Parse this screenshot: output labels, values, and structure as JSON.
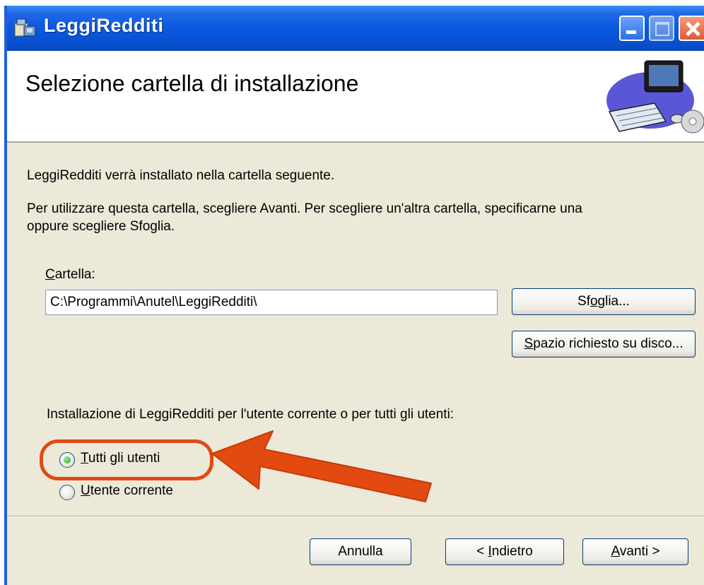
{
  "window": {
    "title": "LeggiRedditi",
    "icon": "installer-icon"
  },
  "titlebar": {
    "minimize": "minimize-icon",
    "maximize": "maximize-icon",
    "close": "close-icon"
  },
  "banner": {
    "title": "Selezione cartella di installazione",
    "graphic": "computer-setup-graphic"
  },
  "body": {
    "intro": "LeggiRedditi verrà installato nella cartella seguente.",
    "instructions_line1": "Per utilizzare questa cartella, scegliere Avanti. Per scegliere un'altra cartella, specificarne una",
    "instructions_line2": "oppure scegliere Sfoglia."
  },
  "folder": {
    "label_access": "C",
    "label_rest": "artella:",
    "value": "C:\\Programmi\\Anutel\\LeggiRedditi\\"
  },
  "browse_button": {
    "pre": "Sf",
    "access": "o",
    "post": "glia..."
  },
  "disk_space_button": {
    "access": "S",
    "post": "pazio richiesto su disco..."
  },
  "install_scope": {
    "question": "Installazione di LeggiRedditi per l'utente corrente o per tutti gli utenti:",
    "options": [
      {
        "access": "T",
        "rest": "utti gli utenti",
        "selected": true
      },
      {
        "access": "U",
        "rest": "tente corrente",
        "selected": false
      }
    ]
  },
  "footer": {
    "cancel": "Annulla",
    "back_pre": "< ",
    "back_access": "I",
    "back_post": "ndietro",
    "next_access": "A",
    "next_post": "vanti >"
  },
  "annotation": {
    "color": "#e24a12"
  }
}
